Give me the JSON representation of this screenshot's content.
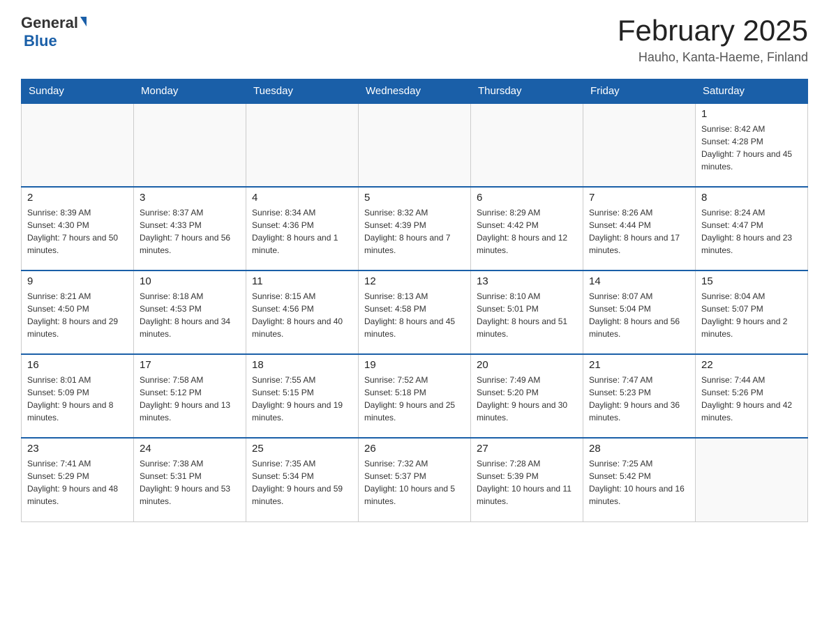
{
  "header": {
    "logo_general": "General",
    "logo_blue": "Blue",
    "title": "February 2025",
    "location": "Hauho, Kanta-Haeme, Finland"
  },
  "weekdays": [
    "Sunday",
    "Monday",
    "Tuesday",
    "Wednesday",
    "Thursday",
    "Friday",
    "Saturday"
  ],
  "weeks": [
    [
      {
        "day": "",
        "sunrise": "",
        "sunset": "",
        "daylight": ""
      },
      {
        "day": "",
        "sunrise": "",
        "sunset": "",
        "daylight": ""
      },
      {
        "day": "",
        "sunrise": "",
        "sunset": "",
        "daylight": ""
      },
      {
        "day": "",
        "sunrise": "",
        "sunset": "",
        "daylight": ""
      },
      {
        "day": "",
        "sunrise": "",
        "sunset": "",
        "daylight": ""
      },
      {
        "day": "",
        "sunrise": "",
        "sunset": "",
        "daylight": ""
      },
      {
        "day": "1",
        "sunrise": "Sunrise: 8:42 AM",
        "sunset": "Sunset: 4:28 PM",
        "daylight": "Daylight: 7 hours and 45 minutes."
      }
    ],
    [
      {
        "day": "2",
        "sunrise": "Sunrise: 8:39 AM",
        "sunset": "Sunset: 4:30 PM",
        "daylight": "Daylight: 7 hours and 50 minutes."
      },
      {
        "day": "3",
        "sunrise": "Sunrise: 8:37 AM",
        "sunset": "Sunset: 4:33 PM",
        "daylight": "Daylight: 7 hours and 56 minutes."
      },
      {
        "day": "4",
        "sunrise": "Sunrise: 8:34 AM",
        "sunset": "Sunset: 4:36 PM",
        "daylight": "Daylight: 8 hours and 1 minute."
      },
      {
        "day": "5",
        "sunrise": "Sunrise: 8:32 AM",
        "sunset": "Sunset: 4:39 PM",
        "daylight": "Daylight: 8 hours and 7 minutes."
      },
      {
        "day": "6",
        "sunrise": "Sunrise: 8:29 AM",
        "sunset": "Sunset: 4:42 PM",
        "daylight": "Daylight: 8 hours and 12 minutes."
      },
      {
        "day": "7",
        "sunrise": "Sunrise: 8:26 AM",
        "sunset": "Sunset: 4:44 PM",
        "daylight": "Daylight: 8 hours and 17 minutes."
      },
      {
        "day": "8",
        "sunrise": "Sunrise: 8:24 AM",
        "sunset": "Sunset: 4:47 PM",
        "daylight": "Daylight: 8 hours and 23 minutes."
      }
    ],
    [
      {
        "day": "9",
        "sunrise": "Sunrise: 8:21 AM",
        "sunset": "Sunset: 4:50 PM",
        "daylight": "Daylight: 8 hours and 29 minutes."
      },
      {
        "day": "10",
        "sunrise": "Sunrise: 8:18 AM",
        "sunset": "Sunset: 4:53 PM",
        "daylight": "Daylight: 8 hours and 34 minutes."
      },
      {
        "day": "11",
        "sunrise": "Sunrise: 8:15 AM",
        "sunset": "Sunset: 4:56 PM",
        "daylight": "Daylight: 8 hours and 40 minutes."
      },
      {
        "day": "12",
        "sunrise": "Sunrise: 8:13 AM",
        "sunset": "Sunset: 4:58 PM",
        "daylight": "Daylight: 8 hours and 45 minutes."
      },
      {
        "day": "13",
        "sunrise": "Sunrise: 8:10 AM",
        "sunset": "Sunset: 5:01 PM",
        "daylight": "Daylight: 8 hours and 51 minutes."
      },
      {
        "day": "14",
        "sunrise": "Sunrise: 8:07 AM",
        "sunset": "Sunset: 5:04 PM",
        "daylight": "Daylight: 8 hours and 56 minutes."
      },
      {
        "day": "15",
        "sunrise": "Sunrise: 8:04 AM",
        "sunset": "Sunset: 5:07 PM",
        "daylight": "Daylight: 9 hours and 2 minutes."
      }
    ],
    [
      {
        "day": "16",
        "sunrise": "Sunrise: 8:01 AM",
        "sunset": "Sunset: 5:09 PM",
        "daylight": "Daylight: 9 hours and 8 minutes."
      },
      {
        "day": "17",
        "sunrise": "Sunrise: 7:58 AM",
        "sunset": "Sunset: 5:12 PM",
        "daylight": "Daylight: 9 hours and 13 minutes."
      },
      {
        "day": "18",
        "sunrise": "Sunrise: 7:55 AM",
        "sunset": "Sunset: 5:15 PM",
        "daylight": "Daylight: 9 hours and 19 minutes."
      },
      {
        "day": "19",
        "sunrise": "Sunrise: 7:52 AM",
        "sunset": "Sunset: 5:18 PM",
        "daylight": "Daylight: 9 hours and 25 minutes."
      },
      {
        "day": "20",
        "sunrise": "Sunrise: 7:49 AM",
        "sunset": "Sunset: 5:20 PM",
        "daylight": "Daylight: 9 hours and 30 minutes."
      },
      {
        "day": "21",
        "sunrise": "Sunrise: 7:47 AM",
        "sunset": "Sunset: 5:23 PM",
        "daylight": "Daylight: 9 hours and 36 minutes."
      },
      {
        "day": "22",
        "sunrise": "Sunrise: 7:44 AM",
        "sunset": "Sunset: 5:26 PM",
        "daylight": "Daylight: 9 hours and 42 minutes."
      }
    ],
    [
      {
        "day": "23",
        "sunrise": "Sunrise: 7:41 AM",
        "sunset": "Sunset: 5:29 PM",
        "daylight": "Daylight: 9 hours and 48 minutes."
      },
      {
        "day": "24",
        "sunrise": "Sunrise: 7:38 AM",
        "sunset": "Sunset: 5:31 PM",
        "daylight": "Daylight: 9 hours and 53 minutes."
      },
      {
        "day": "25",
        "sunrise": "Sunrise: 7:35 AM",
        "sunset": "Sunset: 5:34 PM",
        "daylight": "Daylight: 9 hours and 59 minutes."
      },
      {
        "day": "26",
        "sunrise": "Sunrise: 7:32 AM",
        "sunset": "Sunset: 5:37 PM",
        "daylight": "Daylight: 10 hours and 5 minutes."
      },
      {
        "day": "27",
        "sunrise": "Sunrise: 7:28 AM",
        "sunset": "Sunset: 5:39 PM",
        "daylight": "Daylight: 10 hours and 11 minutes."
      },
      {
        "day": "28",
        "sunrise": "Sunrise: 7:25 AM",
        "sunset": "Sunset: 5:42 PM",
        "daylight": "Daylight: 10 hours and 16 minutes."
      },
      {
        "day": "",
        "sunrise": "",
        "sunset": "",
        "daylight": ""
      }
    ]
  ]
}
